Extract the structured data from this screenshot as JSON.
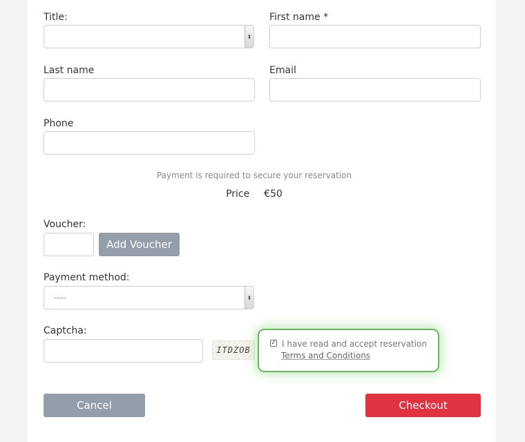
{
  "form": {
    "title_label": "Title:",
    "first_name_label": "First name *",
    "last_name_label": "Last name",
    "email_label": "Email",
    "phone_label": "Phone",
    "payment_note": "Payment is required to secure your reservation",
    "price_label": "Price",
    "price_value": "€50",
    "voucher_label": "Voucher:",
    "add_voucher_button": "Add Voucher",
    "payment_method_label": "Payment method:",
    "payment_method_value": "----",
    "captcha_label": "Captcha:",
    "captcha_text": "ITDZOB",
    "terms_text": "I have read and accept reservation",
    "terms_link": "Terms and Conditions",
    "terms_checked": true,
    "cancel_button": "Cancel",
    "checkout_button": "Checkout"
  },
  "colors": {
    "cancel_bg": "#939eaa",
    "add_voucher_bg": "#939eaa",
    "checkout_bg": "#e0323f",
    "highlight_border": "#69b85b"
  },
  "icons": {
    "select_arrow": "chevron-updown-icon",
    "checkbox": "checkbox-checked-icon"
  }
}
